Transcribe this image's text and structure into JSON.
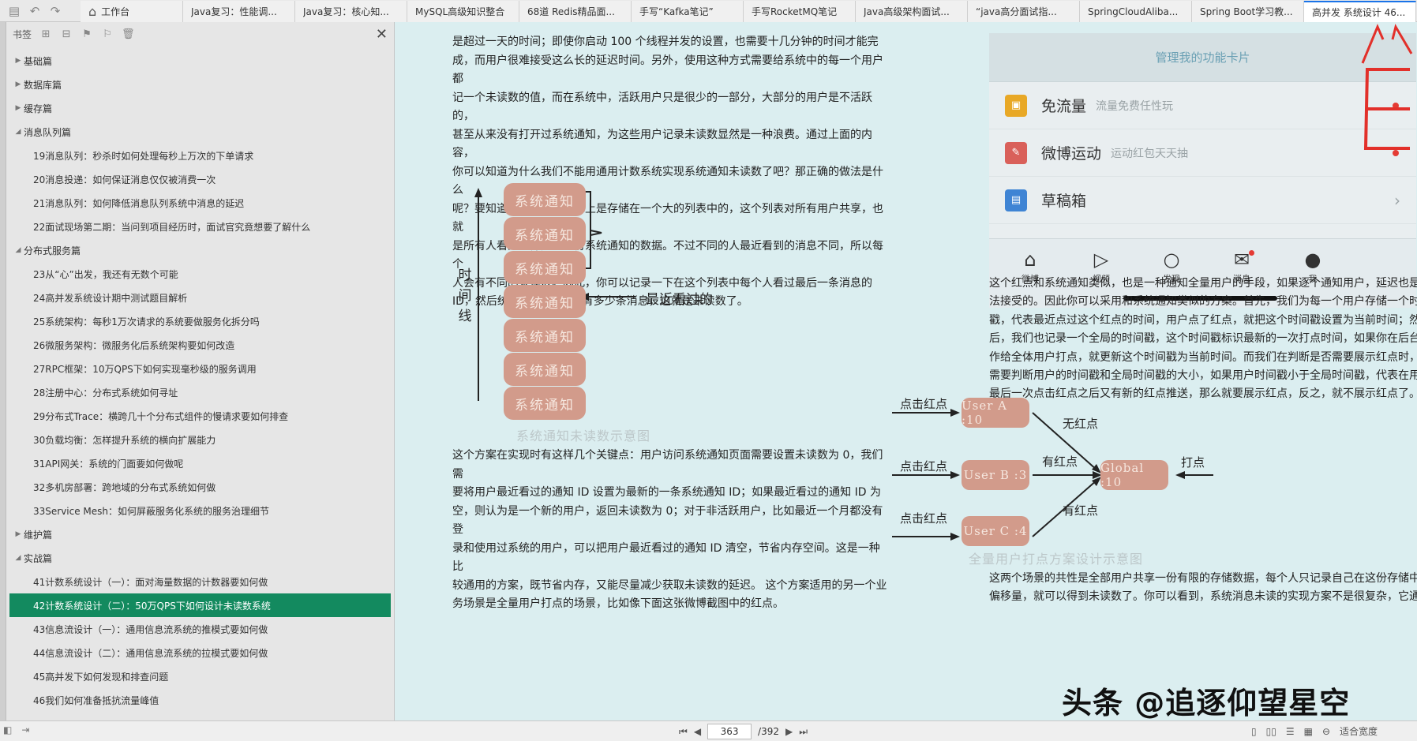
{
  "tabs": [
    {
      "label": "工作台",
      "home": true
    },
    {
      "label": "Java复习：性能调..."
    },
    {
      "label": "Java复习：核心知..."
    },
    {
      "label": "MySQL高级知识整合"
    },
    {
      "label": "68道 Redis精品面..."
    },
    {
      "label": "手写“Kafka笔记”"
    },
    {
      "label": "手写RocketMQ笔记"
    },
    {
      "label": "Java高级架构面试..."
    },
    {
      "label": "“java高分面试指..."
    },
    {
      "label": "SpringCloudAliba..."
    },
    {
      "label": "Spring Boot学习教..."
    },
    {
      "label": "高并发 系统设计 46..."
    }
  ],
  "sidebar": {
    "title": "书签",
    "items": [
      {
        "label": "基础篇",
        "arrow": "▶",
        "child": false
      },
      {
        "label": "数据库篇",
        "arrow": "▶",
        "child": false
      },
      {
        "label": "缓存篇",
        "arrow": "▶",
        "child": false
      },
      {
        "label": "消息队列篇",
        "arrow": "◢",
        "child": false
      },
      {
        "label": "19消息队列：秒杀时如何处理每秒上万次的下单请求",
        "child": true
      },
      {
        "label": "20消息投递：如何保证消息仅仅被消费一次",
        "child": true
      },
      {
        "label": "21消息队列：如何降低消息队列系统中消息的延迟",
        "child": true
      },
      {
        "label": "22面试现场第二期：当问到项目经历时，面试官究竟想要了解什么",
        "child": true
      },
      {
        "label": "分布式服务篇",
        "arrow": "◢",
        "child": false
      },
      {
        "label": "23从“心”出发，我还有无数个可能",
        "child": true
      },
      {
        "label": "24高并发系统设计期中测试题目解析",
        "child": true
      },
      {
        "label": "25系统架构：每秒1万次请求的系统要做服务化拆分吗",
        "child": true
      },
      {
        "label": "26微服务架构：微服务化后系统架构要如何改造",
        "child": true
      },
      {
        "label": "27RPC框架：10万QPS下如何实现毫秒级的服务调用",
        "child": true
      },
      {
        "label": "28注册中心：分布式系统如何寻址",
        "child": true
      },
      {
        "label": "29分布式Trace：横跨几十个分布式组件的慢请求要如何排查",
        "child": true
      },
      {
        "label": "30负载均衡：怎样提升系统的横向扩展能力",
        "child": true
      },
      {
        "label": "31API网关：系统的门面要如何做呢",
        "child": true
      },
      {
        "label": "32多机房部署：跨地域的分布式系统如何做",
        "child": true
      },
      {
        "label": "33Service Mesh：如何屏蔽服务化系统的服务治理细节",
        "child": true
      },
      {
        "label": "维护篇",
        "arrow": "▶",
        "child": false
      },
      {
        "label": "实战篇",
        "arrow": "◢",
        "child": false
      },
      {
        "label": "41计数系统设计（一）：面对海量数据的计数器要如何做",
        "child": true
      },
      {
        "label": "42计数系统设计（二）：50万QPS下如何设计未读数系统",
        "child": true,
        "selected": true
      },
      {
        "label": "43信息流设计（一）：通用信息流系统的推模式要如何做",
        "child": true
      },
      {
        "label": "44信息流设计（二）：通用信息流系统的拉模式要如何做",
        "child": true
      },
      {
        "label": "45高并发下如何发现和排查问题",
        "child": true
      },
      {
        "label": "46我们如何准备抵抗流量峰值",
        "child": true
      }
    ]
  },
  "doc": {
    "col1_p1": [
      "是超过一天的时间；即使你启动 100 个线程并发的设置，也需要十几分钟的时间才能完",
      "成，而用户很难接受这么长的延迟时间。另外，使用这种方式需要给系统中的每一个用户都",
      "记一个未读数的值，而在系统中，活跃用户只是很少的一部分，大部分的用户是不活跃的，",
      "甚至从来没有打开过系统通知，为这些用户记录未读数显然是一种浪费。通过上面的内容，",
      "你可以知道为什么我们不能用通用计数系统实现系统通知未读数了吧？那正确的做法是什么",
      "呢？要知道，系统通知实际上是存储在一个大的列表中的，这个列表对所有用户共享，也就",
      "是所有人看到的都是同一份系统通知的数据。不过不同的人最近看到的消息不同，所以每个",
      "人会有不同的未读数。因此，你可以记录一下在这个列表中每个人看过最后一条消息的",
      "ID，然后统计这个 ID 之后有多少条消息，这就是未读数了。"
    ],
    "diagram1": {
      "pill_label": "系统通知",
      "pill_count": 7,
      "timeline_label": [
        "时",
        "间",
        "线"
      ],
      "pointer_label": "最近看过的",
      "caption": "系统通知未读数示意图"
    },
    "col1_p2": [
      "这个方案在实现时有这样几个关键点：用户访问系统通知页面需要设置未读数为 0，我们需",
      "要将用户最近看过的通知 ID 设置为最新的一条系统通知 ID；如果最近看过的通知 ID 为",
      "空，则认为是一个新的用户，返回未读数为 0；对于非活跃用户，比如最近一个月都没有登",
      "录和使用过系统的用户，可以把用户最近看过的通知 ID 清空，节省内存空间。这是一种比",
      "较通用的方案，既节省内存，又能尽量减少获取未读数的延迟。 这个方案适用的另一个业",
      "务场景是全量用户打点的场景，比如像下面这张微博截图中的红点。"
    ],
    "card": {
      "header": "管理我的功能卡片",
      "rows": [
        {
          "name": "免流量",
          "sub": "流量免费任性玩",
          "icon": "▣",
          "color": "#e8a826",
          "end": "dot"
        },
        {
          "name": "微博运动",
          "sub": "运动红包天天抽",
          "icon": "✎",
          "color": "#d9605a",
          "end": "dot"
        },
        {
          "name": "草稿箱",
          "sub": "",
          "icon": "▤",
          "color": "#3f84d4",
          "end": "chevron"
        }
      ],
      "nav": [
        {
          "label": "微博",
          "glyph": "⌂"
        },
        {
          "label": "视频",
          "glyph": "▷"
        },
        {
          "label": "发现",
          "glyph": "○"
        },
        {
          "label": "消息",
          "glyph": "✉"
        },
        {
          "label": "我",
          "glyph": "●"
        }
      ]
    },
    "col2_p1": [
      "这个红点和系统通知类似，也是一种通知全量用户的手段，如果逐个通知用户，延迟也是无",
      "法接受的。因此你可以采用和系统通知类似的方案。首先，我们为每一个用户存储一个时间",
      "戳，代表最近点过这个红点的时间，用户点了红点，就把这个时间戳设置为当前时间；然",
      "后，我们也记录一个全局的时间戳，这个时间戳标识最新的一次打点时间，如果你在后台操",
      "作给全体用户打点，就更新这个时间戳为当前时间。而我们在判断是否需要展示红点时，只",
      "需要判断用户的时间戳和全局时间戳的大小，如果用户时间戳小于全局时间戳，代表在用户",
      "最后一次点击红点之后又有新的红点推送，那么就要展示红点，反之，就不展示红点了。"
    ],
    "diagram2": {
      "users": [
        "User A :10",
        "User B :3",
        "User C :4"
      ],
      "global": "Global :10",
      "click_label": "点击红点",
      "edge_labels": [
        "无红点",
        "有红点",
        "有红点"
      ],
      "dot_label": "打点",
      "caption": "全量用户打点方案设计示意图"
    },
    "col2_p2": [
      "这两个场景的共性是全部用户共享一份有限的存储数据，每个人只记录自己在这份存储中的",
      "偏移量，就可以得到未读数了。你可以看到，系统消息未读的实现方案不是很复杂，它通过"
    ]
  },
  "status": {
    "page": "363",
    "total": "/392",
    "zoom": "适合宽度"
  },
  "watermark": "头条 @追逐仰望星空"
}
